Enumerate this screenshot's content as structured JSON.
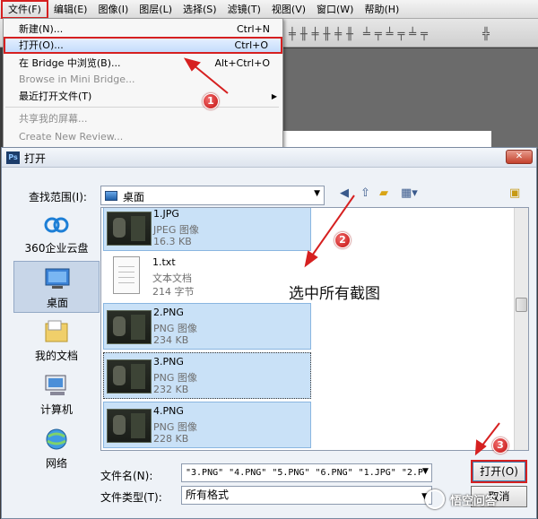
{
  "menubar": {
    "items": [
      "文件(F)",
      "编辑(E)",
      "图像(I)",
      "图层(L)",
      "选择(S)",
      "滤镜(T)",
      "视图(V)",
      "窗口(W)",
      "帮助(H)"
    ]
  },
  "file_menu": {
    "items": [
      {
        "label": "新建(N)...",
        "shortcut": "Ctrl+N"
      },
      {
        "label": "打开(O)...",
        "shortcut": "Ctrl+O"
      },
      {
        "label": "在 Bridge 中浏览(B)...",
        "shortcut": "Alt+Ctrl+O"
      },
      {
        "label": "Browse in Mini Bridge...",
        "shortcut": ""
      },
      {
        "label": "最近打开文件(T)",
        "shortcut": ""
      },
      {
        "label": "共享我的屏幕...",
        "shortcut": ""
      },
      {
        "label": "Create New Review...",
        "shortcut": ""
      }
    ]
  },
  "annotations": {
    "step1": "1",
    "step2": "2",
    "step3": "3",
    "text": "选中所有截图"
  },
  "dialog": {
    "app_badge": "Ps",
    "title": "打开",
    "close_glyph": "✕",
    "look_in_label": "查找范围(I):",
    "look_in_value": "桌面",
    "places": [
      {
        "label": "360企业云盘"
      },
      {
        "label": "桌面"
      },
      {
        "label": "我的文档"
      },
      {
        "label": "计算机"
      },
      {
        "label": "网络"
      }
    ],
    "files": [
      {
        "name": "1.JPG",
        "type": "JPEG 图像",
        "size": "16.3 KB"
      },
      {
        "name": "1.txt",
        "type": "文本文档",
        "size": "214 字节"
      },
      {
        "name": "2.PNG",
        "type": "PNG 图像",
        "size": "234 KB"
      },
      {
        "name": "3.PNG",
        "type": "PNG 图像",
        "size": "232 KB"
      },
      {
        "name": "4.PNG",
        "type": "PNG 图像",
        "size": "228 KB"
      }
    ],
    "file_name_label": "文件名(N):",
    "file_name_value": "\"3.PNG\" \"4.PNG\" \"5.PNG\" \"6.PNG\" \"1.JPG\" \"2.P",
    "file_type_label": "文件类型(T):",
    "file_type_value": "所有格式",
    "open_button": "打开(O)",
    "cancel_button": "取消"
  },
  "watermark": {
    "text": "悟空问答"
  },
  "colors": {
    "annotation_red": "#d62020",
    "selection_blue": "#c9e1f7"
  }
}
